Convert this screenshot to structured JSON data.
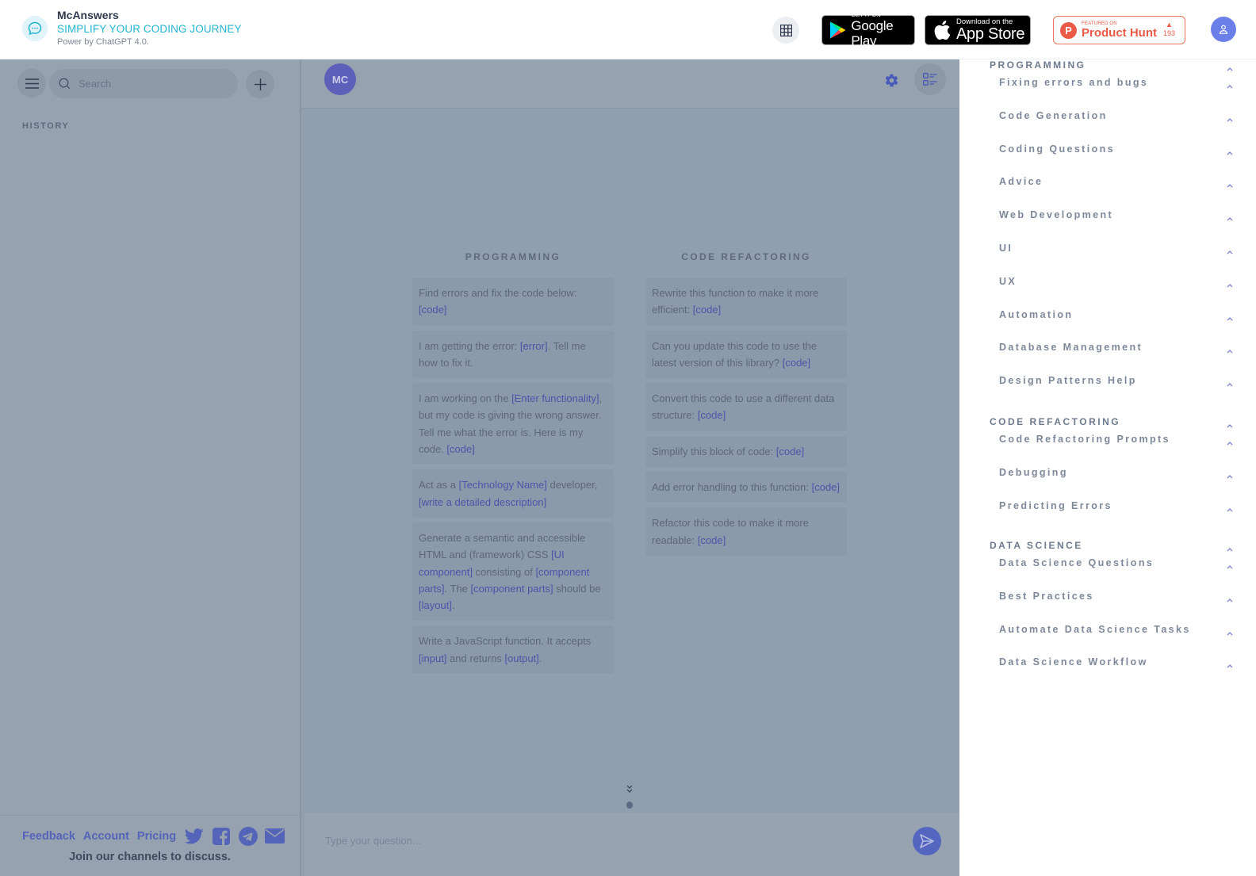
{
  "header": {
    "brand_name": "McAnswers",
    "tagline": "SIMPLIFY YOUR CODING JOURNEY",
    "powered_by": "Power by ChatGPT 4.0.",
    "google_play": {
      "small": "GET IT ON",
      "big": "Google Play"
    },
    "app_store": {
      "small": "Download on the",
      "big": "App Store"
    },
    "product_hunt": {
      "small": "FEATURED ON",
      "big": "Product Hunt",
      "votes": "193"
    },
    "colors": {
      "tagline": "#22b5cf",
      "user_avatar": "#6b7fe8",
      "product_hunt": "#ea5a47"
    }
  },
  "sidebar": {
    "search_placeholder": "Search",
    "history_label": "HISTORY",
    "footer_links": [
      "Feedback",
      "Account",
      "Pricing"
    ],
    "social_icons": [
      "twitter-icon",
      "facebook-icon",
      "telegram-icon",
      "email-icon"
    ],
    "join_text": "Join our channels to discuss."
  },
  "chat": {
    "avatar_initials": "MC",
    "input_placeholder": "Type your question...",
    "columns": [
      {
        "title": "PROGRAMMING",
        "prompts": [
          [
            {
              "t": "Find errors and fix the code below: "
            },
            {
              "p": "[code]"
            }
          ],
          [
            {
              "t": "I am getting the error: "
            },
            {
              "p": "[error]"
            },
            {
              "t": ". Tell me how to fix it."
            }
          ],
          [
            {
              "t": "I am working on the "
            },
            {
              "p": "[Enter functionality]"
            },
            {
              "t": ", but my code is giving the wrong answer. Tell me what the error is. Here is my code. "
            },
            {
              "p": "[code]"
            }
          ],
          [
            {
              "t": "Act as a "
            },
            {
              "p": "[Technology Name]"
            },
            {
              "t": " developer, "
            },
            {
              "p": "[write a detailed description]"
            }
          ],
          [
            {
              "t": "Generate a semantic and accessible HTML and (framework) CSS "
            },
            {
              "p": "[UI component]"
            },
            {
              "t": " consisting of "
            },
            {
              "p": "[component parts]"
            },
            {
              "t": ". The "
            },
            {
              "p": "[component parts]"
            },
            {
              "t": " should be "
            },
            {
              "p": "[layout]"
            },
            {
              "t": "."
            }
          ],
          [
            {
              "t": "Write a JavaScript function. It accepts "
            },
            {
              "p": "[input]"
            },
            {
              "t": " and returns "
            },
            {
              "p": "[output]"
            },
            {
              "t": "."
            }
          ]
        ]
      },
      {
        "title": "CODE REFACTORING",
        "prompts": [
          [
            {
              "t": "Rewrite this function to make it more efficient: "
            },
            {
              "p": "[code]"
            }
          ],
          [
            {
              "t": "Can you update this code to use the latest version of this library? "
            },
            {
              "p": "[code]"
            }
          ],
          [
            {
              "t": "Convert this code to use a different data structure: "
            },
            {
              "p": "[code]"
            }
          ],
          [
            {
              "t": "Simplify this block of code: "
            },
            {
              "p": "[code]"
            }
          ],
          [
            {
              "t": "Add error handling to this function: "
            },
            {
              "p": "[code]"
            }
          ],
          [
            {
              "t": "Refactor this code to make it more readable: "
            },
            {
              "p": "[code]"
            }
          ]
        ]
      }
    ]
  },
  "categories": [
    {
      "title": "PROGRAMMING",
      "items": [
        "Fixing errors and bugs",
        "Code Generation",
        "Coding Questions",
        "Advice",
        "Web Development",
        "UI",
        "UX",
        "Automation",
        "Database Management",
        "Design Patterns Help"
      ]
    },
    {
      "title": "CODE REFACTORING",
      "items": [
        "Code Refactoring Prompts",
        "Debugging",
        "Predicting Errors"
      ]
    },
    {
      "title": "DATA SCIENCE",
      "items": [
        "Data Science Questions",
        "Best Practices",
        "Automate Data Science Tasks",
        "Data Science Workflow"
      ]
    }
  ]
}
